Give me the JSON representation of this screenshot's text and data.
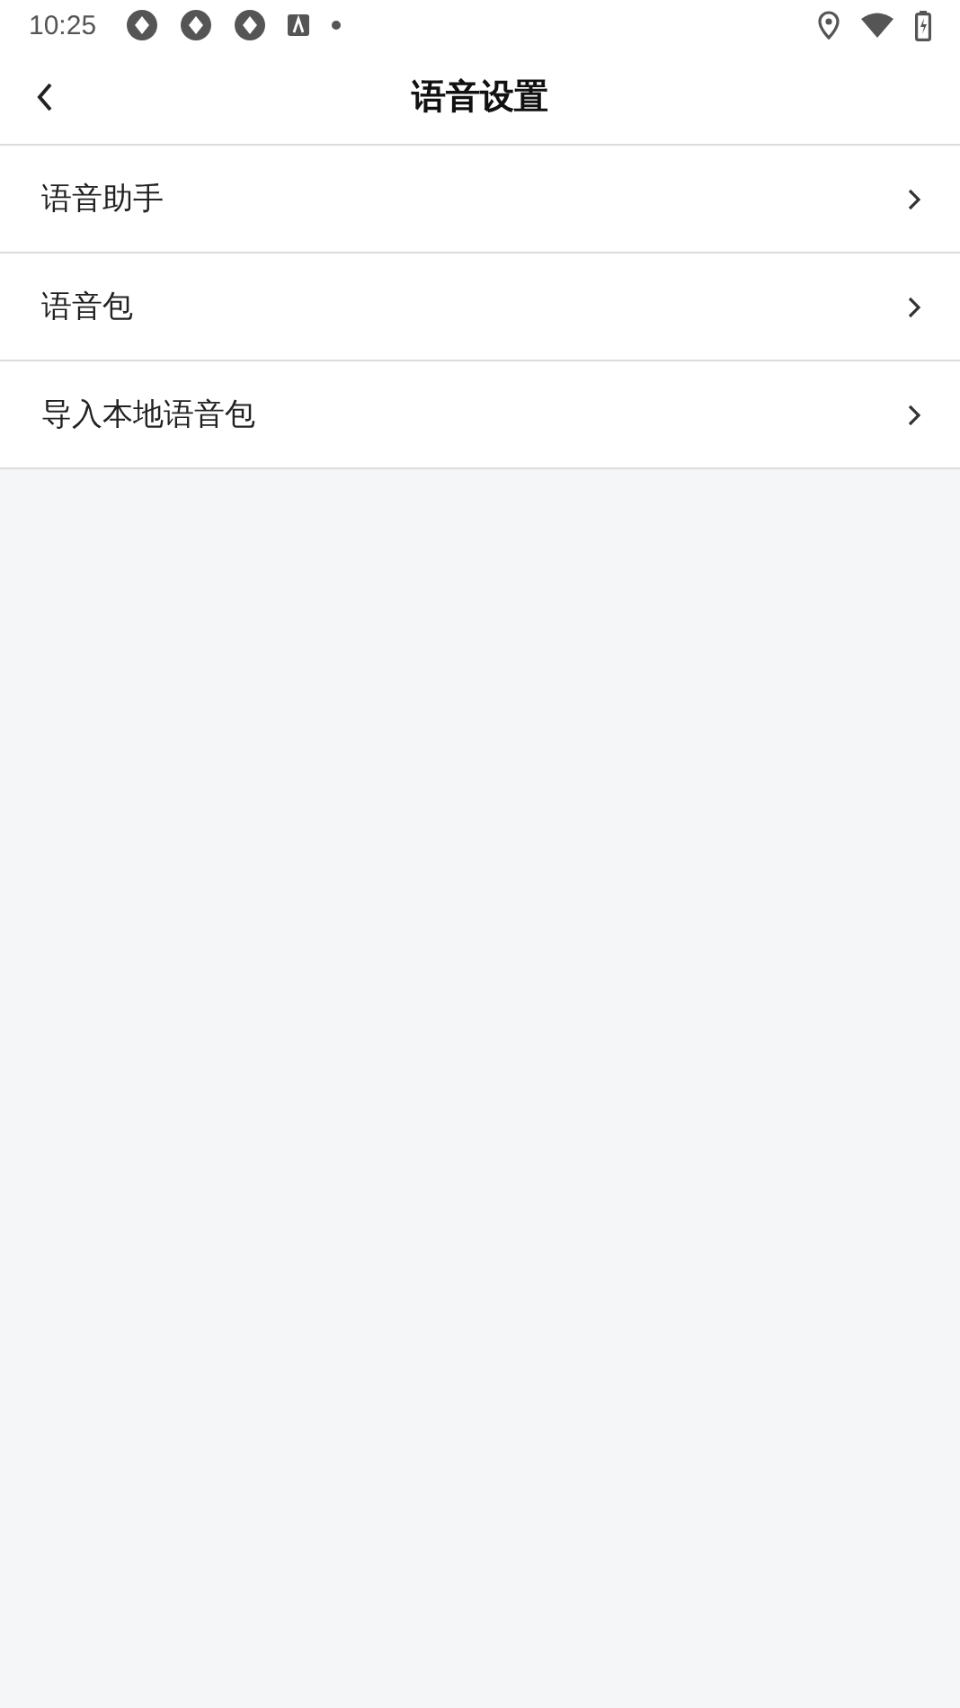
{
  "status_bar": {
    "time": "10:25"
  },
  "header": {
    "title": "语音设置"
  },
  "menu_items": [
    {
      "label": "语音助手"
    },
    {
      "label": "语音包"
    },
    {
      "label": "导入本地语音包"
    }
  ]
}
